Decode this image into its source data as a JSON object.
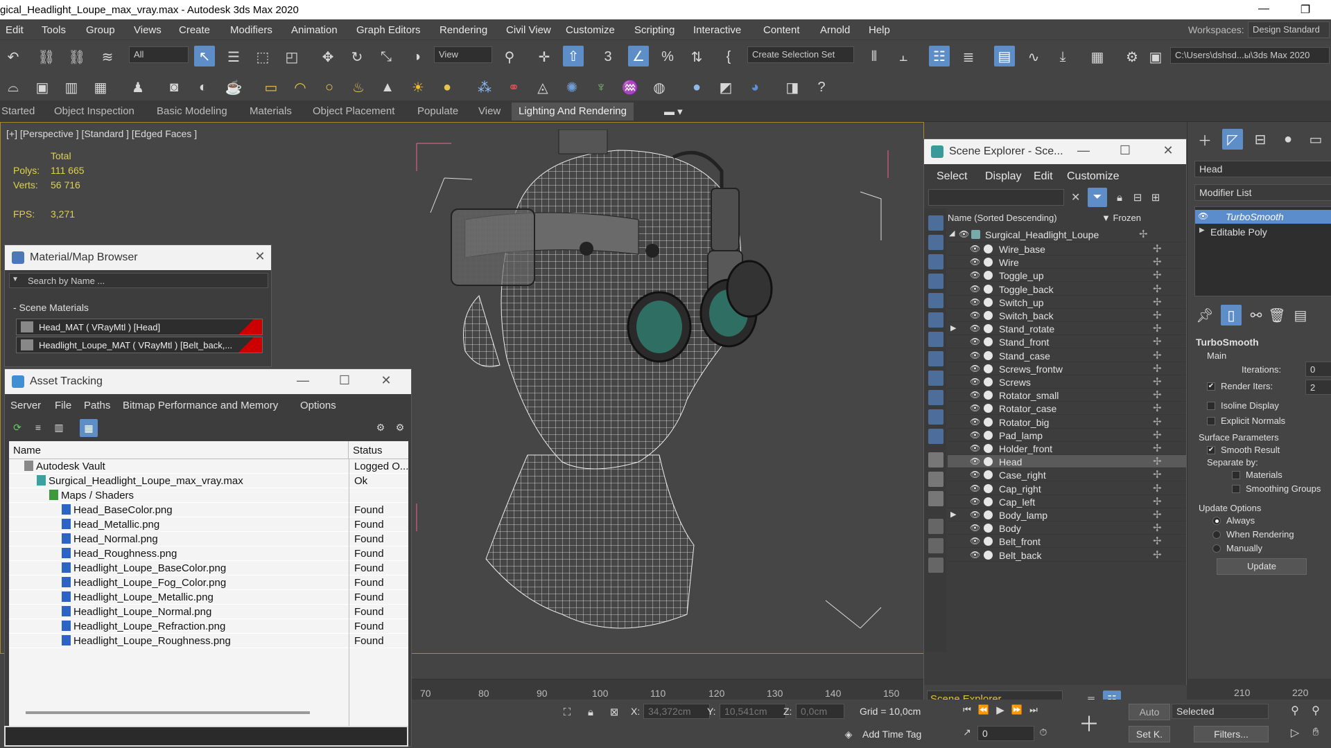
{
  "window": {
    "title": "gical_Headlight_Loupe_max_vray.max - Autodesk 3ds Max 2020",
    "minimize": "—",
    "restore": "❐"
  },
  "menu": [
    "Edit",
    "Tools",
    "Group",
    "Views",
    "Create",
    "Modifiers",
    "Animation",
    "Graph Editors",
    "Rendering",
    "Civil View",
    "Customize",
    "Scripting",
    "Interactive",
    "Content",
    "Arnold",
    "Help"
  ],
  "workspaces": {
    "label": "Workspaces:",
    "value": "Design Standard"
  },
  "toolbar": {
    "filter": "All",
    "refcoord": "View",
    "selset": "Create Selection Set",
    "path": "C:\\Users\\dshsd...ы\\3ds Max 2020"
  },
  "ribbon": [
    "Started",
    "Object Inspection",
    "Basic Modeling",
    "Materials",
    "Object Placement",
    "Populate",
    "View",
    "Lighting And Rendering"
  ],
  "viewport": {
    "label": "[+] [Perspective ] [Standard ] [Edged Faces ]",
    "total": "Total",
    "polys_label": "Polys:",
    "polys": "111 665",
    "verts_label": "Verts:",
    "verts": "56 716",
    "fps_label": "FPS:",
    "fps": "3,271"
  },
  "material_browser": {
    "title": "Material/Map Browser",
    "search": "Search by Name ...",
    "section": "- Scene Materials",
    "items": [
      "Head_MAT  ( VRayMtl )  [Head]",
      "Headlight_Loupe_MAT  ( VRayMtl )  [Belt_back,..."
    ]
  },
  "asset_tracking": {
    "title": "Asset Tracking",
    "menu": [
      "Server",
      "File",
      "Paths",
      "Bitmap Performance and Memory",
      "Options"
    ],
    "col_name": "Name",
    "col_status": "Status",
    "rows": [
      {
        "name": "Autodesk Vault",
        "status": "Logged O..."
      },
      {
        "name": "Surgical_Headlight_Loupe_max_vray.max",
        "status": "Ok"
      },
      {
        "name": "Maps / Shaders",
        "status": ""
      },
      {
        "name": "Head_BaseColor.png",
        "status": "Found"
      },
      {
        "name": "Head_Metallic.png",
        "status": "Found"
      },
      {
        "name": "Head_Normal.png",
        "status": "Found"
      },
      {
        "name": "Head_Roughness.png",
        "status": "Found"
      },
      {
        "name": "Headlight_Loupe_BaseColor.png",
        "status": "Found"
      },
      {
        "name": "Headlight_Loupe_Fog_Color.png",
        "status": "Found"
      },
      {
        "name": "Headlight_Loupe_Metallic.png",
        "status": "Found"
      },
      {
        "name": "Headlight_Loupe_Normal.png",
        "status": "Found"
      },
      {
        "name": "Headlight_Loupe_Refraction.png",
        "status": "Found"
      },
      {
        "name": "Headlight_Loupe_Roughness.png",
        "status": "Found"
      }
    ]
  },
  "scene_explorer": {
    "title": "Scene Explorer - Sce...",
    "menu": [
      "Select",
      "Display",
      "Edit",
      "Customize"
    ],
    "col_name": "Name (Sorted Descending)",
    "col_frozen": "▼ Frozen",
    "root": "Surgical_Headlight_Loupe",
    "items": [
      "Wire_base",
      "Wire",
      "Toggle_up",
      "Toggle_back",
      "Switch_up",
      "Switch_back",
      "Stand_rotate",
      "Stand_front",
      "Stand_case",
      "Screws_frontw",
      "Screws",
      "Rotator_small",
      "Rotator_case",
      "Rotator_big",
      "Pad_lamp",
      "Holder_front",
      "Head",
      "Case_right",
      "Cap_right",
      "Cap_left",
      "Body_lamp",
      "Body",
      "Belt_front",
      "Belt_back"
    ],
    "footer": "Scene Explorer"
  },
  "timeline": {
    "ticks": [
      "70",
      "80",
      "90",
      "100",
      "110",
      "120",
      "130",
      "140",
      "150"
    ],
    "right_ticks": [
      "210",
      "220"
    ]
  },
  "status": {
    "x_label": "X:",
    "x": "34,372cm",
    "y_label": "Y:",
    "y": "10,541cm",
    "z_label": "Z:",
    "z": "0,0cm",
    "grid": "Grid = 10,0cm",
    "add_time_tag": "Add Time Tag",
    "auto": "Auto",
    "selected": "Selected",
    "set_key": "Set K.",
    "filters": "Filters...",
    "frame": "0"
  },
  "command_panel": {
    "object_name": "Head",
    "modifier_list": "Modifier List",
    "stack": [
      "TurboSmooth",
      "Editable Poly"
    ],
    "rollout": "TurboSmooth",
    "main": "Main",
    "iterations_label": "Iterations:",
    "iterations": "0",
    "render_iters_label": "Render Iters:",
    "render_iters": "2",
    "isoline": "Isoline Display",
    "explicit": "Explicit Normals",
    "surface": "Surface Parameters",
    "smooth_result": "Smooth Result",
    "separate_by": "Separate by:",
    "materials": "Materials",
    "smoothing_groups": "Smoothing Groups",
    "update_options": "Update Options",
    "always": "Always",
    "when_rendering": "When Rendering",
    "manually": "Manually",
    "update": "Update"
  }
}
